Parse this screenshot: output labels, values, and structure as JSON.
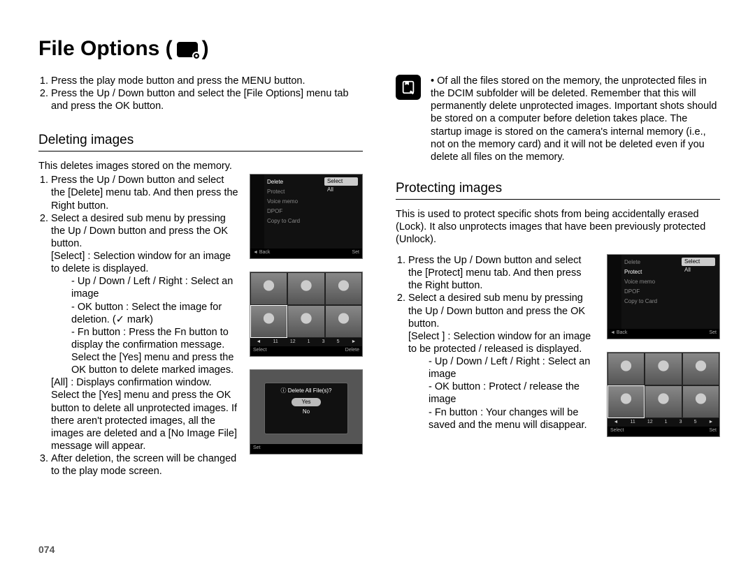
{
  "page_number": "074",
  "title": "File Options (",
  "title_close": ")",
  "intro_steps": [
    "Press the play mode button and press the MENU button.",
    "Press the Up / Down button and select the [File Options] menu tab and press the OK button."
  ],
  "deleting": {
    "heading": "Deleting images",
    "lead": "This deletes images stored on the memory.",
    "step1": "Press the Up / Down button and select the [Delete] menu tab. And then press the Right button.",
    "step2": "Select a desired sub menu by pressing the Up / Down button and press the OK button.",
    "select_label": "[Select] : Selection window for an image to delete is displayed.",
    "bullet_nav": "- Up / Down / Left / Right : Select an image",
    "bullet_ok_pre": "- OK button : Select the image for deletion. (",
    "bullet_ok_post": " mark)",
    "check_glyph": "✓",
    "bullet_fn": "- Fn button : Press the Fn button to display the confirmation message. Select the [Yes] menu and press the OK button to delete marked images.",
    "all_label": "[All] : Displays confirmation window. Select the [Yes] menu and press the OK button to delete all unprotected images. If there aren't protected images, all the images are deleted and a [No Image File] message will appear.",
    "step3": "After deletion, the screen will be changed to the play mode screen.",
    "fig1": {
      "menu": [
        "Delete",
        "Protect",
        "Voice memo",
        "DPOF",
        "Copy to Card"
      ],
      "highlight": "Delete",
      "submenu": [
        "Select",
        "All"
      ],
      "selected": "Select",
      "bar_left": "Back",
      "bar_right": "Set"
    },
    "fig2": {
      "ticks": [
        "11",
        "12",
        "1",
        "3",
        "5"
      ],
      "bar_left": "Select",
      "bar_right": "Delete"
    },
    "fig3": {
      "question": "Delete All File(s)?",
      "opt1": "Yes",
      "opt2": "No",
      "bar_left": "Set"
    }
  },
  "note_bullet_prefix": "• ",
  "note_text": "Of all the files stored on the memory, the unprotected files in the DCIM subfolder will be deleted. Remember that this will permanently delete unprotected images. Important shots should be stored on a computer before deletion takes place. The startup image is stored on the camera's internal memory (i.e., not on the memory card) and it will not be deleted even if you delete all files on the memory.",
  "protecting": {
    "heading": "Protecting images",
    "lead": "This is used to protect specific shots from being accidentally erased (Lock). It also unprotects images that have been previously protected (Unlock).",
    "step1": "Press the Up / Down button and select the [Protect] menu tab. And then press the Right button.",
    "step2": "Select a desired sub menu by pressing the Up / Down button and press the OK button.",
    "select_label": "[Select ] : Selection window for an image to be protected / released is displayed.",
    "bullet_nav": "- Up / Down / Left / Right : Select an image",
    "bullet_ok": "- OK button : Protect / release the image",
    "bullet_fn": "- Fn button : Your changes will be saved and the menu will disappear.",
    "fig1": {
      "menu": [
        "Delete",
        "Protect",
        "Voice memo",
        "DPOF",
        "Copy to Card"
      ],
      "highlight": "Protect",
      "submenu": [
        "Select",
        "All"
      ],
      "selected": "Select",
      "bar_left": "Back",
      "bar_right": "Set"
    },
    "fig2": {
      "ticks": [
        "11",
        "12",
        "1",
        "3",
        "5"
      ],
      "bar_left": "Select",
      "bar_right": "Set"
    }
  }
}
